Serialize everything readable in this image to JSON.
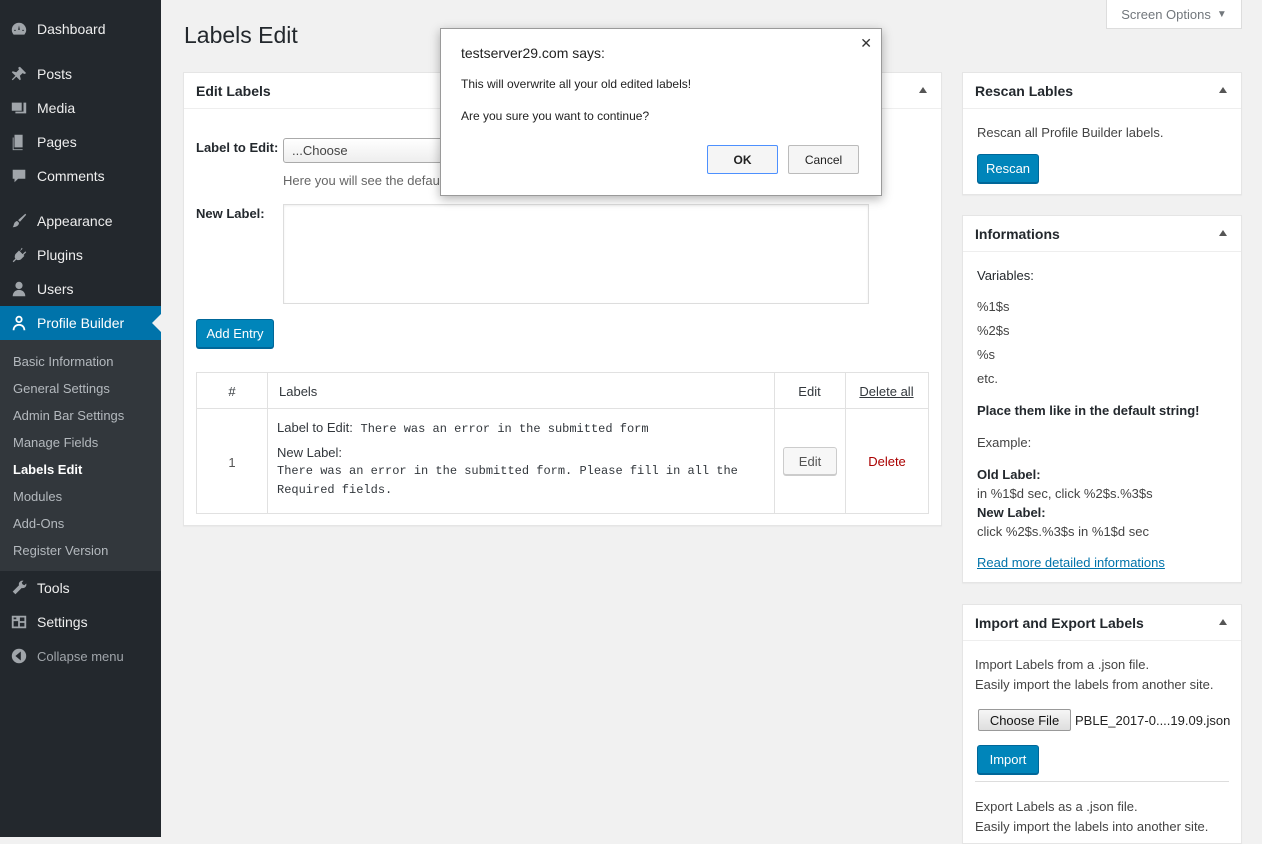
{
  "sidebar": {
    "items": [
      {
        "label": "Dashboard",
        "icon": "dashboard-icon"
      },
      {
        "label": "Posts",
        "icon": "pin-icon"
      },
      {
        "label": "Media",
        "icon": "media-icon"
      },
      {
        "label": "Pages",
        "icon": "pages-icon"
      },
      {
        "label": "Comments",
        "icon": "comment-icon"
      },
      {
        "label": "Appearance",
        "icon": "brush-icon"
      },
      {
        "label": "Plugins",
        "icon": "plug-icon"
      },
      {
        "label": "Users",
        "icon": "user-icon"
      },
      {
        "label": "Profile Builder",
        "icon": "profile-icon"
      },
      {
        "label": "Tools",
        "icon": "wrench-icon"
      },
      {
        "label": "Settings",
        "icon": "settings-icon"
      }
    ],
    "submenu": [
      "Basic Information",
      "General Settings",
      "Admin Bar Settings",
      "Manage Fields",
      "Labels Edit",
      "Modules",
      "Add-Ons",
      "Register Version"
    ],
    "collapse_label": "Collapse menu"
  },
  "header": {
    "title": "Labels Edit",
    "screen_options": "Screen Options"
  },
  "edit_labels": {
    "title": "Edit Labels",
    "label_to_edit": "Label to Edit:",
    "select_value": "...Choose",
    "hint": "Here you will see the defaul",
    "new_label": "New Label:",
    "add_entry": "Add Entry",
    "table": {
      "col_num": "#",
      "col_labels": "Labels",
      "col_edit": "Edit",
      "col_delete_all": "Delete all",
      "rows": [
        {
          "num": "1",
          "label_prefix": "Label to Edit:",
          "label_value": "There was an error in the submitted form",
          "new_prefix": "New Label:",
          "new_value_1": "There was an error in the submitted form. Please fill in all the",
          "new_value_2": "Required fields.",
          "edit": "Edit",
          "delete": "Delete"
        }
      ]
    }
  },
  "rescan": {
    "title": "Rescan Lables",
    "text": "Rescan all Profile Builder labels.",
    "button": "Rescan"
  },
  "informations": {
    "title": "Informations",
    "variables_label": "Variables:",
    "vars": [
      "%1$s",
      "%2$s",
      "%s",
      "etc."
    ],
    "place_them": "Place them like in the default string!",
    "example": "Example:",
    "old_label": "Old Label:",
    "old_value": "in %1$d sec, click %2$s.%3$s",
    "new_label": "New Label:",
    "new_value": "click %2$s.%3$s in %1$d sec",
    "link": "Read more detailed informations"
  },
  "import_export": {
    "title": "Import and Export Labels",
    "import_line1": "Import Labels from a .json file.",
    "import_line2": "Easily import the labels from another site.",
    "choose_file": "Choose File",
    "file_name": "PBLE_2017-0....19.09.json",
    "import_button": "Import",
    "export_line1": "Export Labels as a .json file.",
    "export_line2": "Easily import the labels into another site."
  },
  "dialog": {
    "title": "testserver29.com says:",
    "message": "This will overwrite all your old edited labels!",
    "question": "Are you sure you want to continue?",
    "ok": "OK",
    "cancel": "Cancel"
  },
  "colors": {
    "sidebar_bg": "#23282d",
    "submenu_bg": "#32373c",
    "accent": "#0073aa",
    "primary_button": "#0085ba",
    "delete_link": "#a00"
  }
}
